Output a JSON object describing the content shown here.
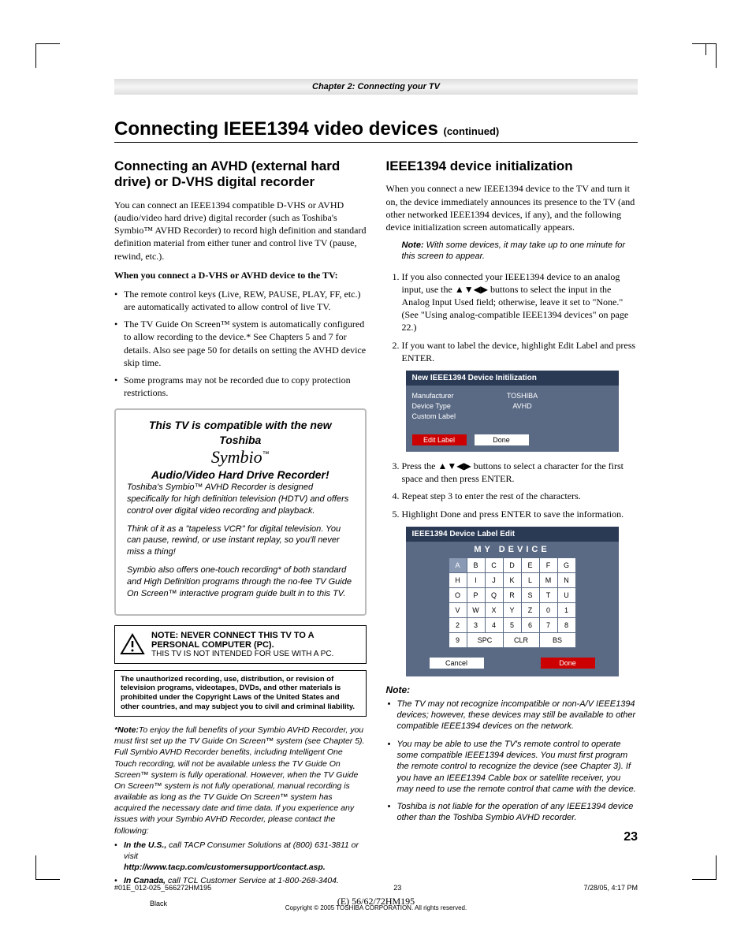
{
  "chapter": "Chapter 2: Connecting your TV",
  "h1": "Connecting IEEE1394 video devices ",
  "h1cont": "(continued)",
  "left": {
    "h2": "Connecting an AVHD (external hard drive) or D-VHS digital recorder",
    "p1": "You can connect an IEEE1394 compatible D-VHS or AVHD (audio/video hard drive) digital recorder (such as Toshiba's Symbio™ AVHD Recorder) to record high definition and standard definition material from either tuner and control live TV (pause, rewind, etc.).",
    "intro": "When you connect a D-VHS or AVHD device to the TV:",
    "b1": "The remote control keys (Live, REW, PAUSE, PLAY, FF, etc.) are automatically activated to allow control of live TV.",
    "b2": "The TV Guide On Screen™ system is automatically configured to allow recording to the device.* See Chapters 5 and 7 for details. Also see page 50 for details on setting the AVHD device skip time.",
    "b3": "Some programs may not be recorded due to copy protection restrictions.",
    "sbox": {
      "l1": "This TV is compatible with the new Toshiba",
      "brand": "Symbio",
      "l2": "Audio/Video Hard Drive Recorder!",
      "p1": "Toshiba's Symbio™ AVHD Recorder is designed specifically for high definition television (HDTV) and offers control over digital video recording and playback.",
      "p2": "Think of it as a \"tapeless VCR\" for digital television. You can pause, rewind, or use instant replay, so you'll never miss a thing!",
      "p3": "Symbio also offers one-touch recording* of both standard and High Definition programs through the no-fee TV Guide On Screen™ interactive program guide built in to this TV."
    },
    "warn": {
      "l1": "NOTE: NEVER CONNECT THIS TV TO A PERSONAL COMPUTER (PC).",
      "l2": "THIS TV IS NOT INTENDED FOR USE WITH A PC."
    },
    "legal": "The unauthorized recording, use, distribution, or revision of television programs, videotapes, DVDs, and other materials is prohibited under the Copyright Laws of the United States and other countries, and may subject you to civil and criminal liability.",
    "fn": {
      "lead": "*Note:",
      "body": "To enjoy the full benefits of your Symbio AVHD Recorder, you must first set up the TV Guide On Screen™ system (see Chapter 5). Full Symbio AVHD Recorder benefits, including Intelligent One Touch recording, will not be available unless the TV Guide On Screen™ system is fully operational. However, when the TV Guide On Screen™ system is not fully operational, manual recording is available as long as the TV Guide On Screen™ system has acquired the necessary date and time data. If you experience any issues with your Symbio AVHD Recorder, please contact the following:",
      "us1": "In the U.S.,",
      "us2": " call TACP Consumer Solutions at (800) 631-3811 or visit",
      "url": "http://www.tacp.com/customersupport/contact.asp.",
      "ca1": "In Canada,",
      "ca2": " call TCL Customer Service at 1-800-268-3404."
    }
  },
  "right": {
    "h2": "IEEE1394 device initialization",
    "p1": "When you connect a new IEEE1394 device to the TV and turn it on, the device immediately announces its presence to the TV (and other networked IEEE1394 devices, if any), and the following device initialization screen automatically appears.",
    "note": " With some devices, it may take up to one minute for this screen to appear.",
    "s1a": "If you also connected your IEEE1394 device to an analog input, use the ",
    "s1b": " buttons to select the input in the Analog Input Used field; otherwise, leave it set to \"None.\" (See \"Using analog-compatible IEEE1394 devices\" on page 22.)",
    "s2": "If you want to label the device, highlight Edit Label and press ENTER.",
    "osd1": {
      "title": "New IEEE1394 Device Initilization",
      "mfr_l": "Manufacturer",
      "mfr_v": "TOSHIBA",
      "dt_l": "Device Type",
      "dt_v": "AVHD",
      "cl_l": "Custom Label",
      "edit": "Edit Label",
      "done": "Done"
    },
    "s3a": "Press the ",
    "s3b": " buttons to select a character for the first space and then press ENTER.",
    "s4": "Repeat step 3 to enter the rest of the characters.",
    "s5": "Highlight Done and press ENTER to save the information.",
    "osd2": {
      "title": "IEEE1394 Device Label Edit",
      "text": "MY  DEVICE",
      "cancel": "Cancel",
      "done": "Done",
      "spc": "SPC",
      "clr": "CLR",
      "bs": "BS"
    },
    "grid": [
      [
        "A",
        "B",
        "C",
        "D",
        "E",
        "F",
        "G"
      ],
      [
        "H",
        "I",
        "J",
        "K",
        "L",
        "M",
        "N"
      ],
      [
        "O",
        "P",
        "Q",
        "R",
        "S",
        "T",
        "U"
      ],
      [
        "V",
        "W",
        "X",
        "Y",
        "Z",
        "0",
        "1"
      ],
      [
        "2",
        "3",
        "4",
        "5",
        "6",
        "7",
        "8"
      ]
    ],
    "noteh": "Note:",
    "n1": "The TV may not recognize incompatible or non-A/V IEEE1394 devices; however, these devices may still be available to other compatible IEEE1394 devices on the network.",
    "n2": "You may be able to use the TV's remote control to operate some compatible IEEE1394 devices. You must first program the remote control to recognize the device (see Chapter 3). If you have an IEEE1394 Cable box or satellite receiver, you may need to use the remote control that came with the device.",
    "n3": "Toshiba is not liable for the operation of any IEEE1394 device other than the Toshiba Symbio AVHD recorder."
  },
  "arrows": "▲▼◀▶",
  "copyright": "Copyright © 2005 TOSHIBA CORPORATION. All rights reserved.",
  "pagenum": "23",
  "foot": {
    "file": "#01E_012-025_566272HM195",
    "pg": "23",
    "date": "7/28/05, 4:17 PM",
    "black": "Black",
    "model": "(E) 56/62/72HM195"
  }
}
